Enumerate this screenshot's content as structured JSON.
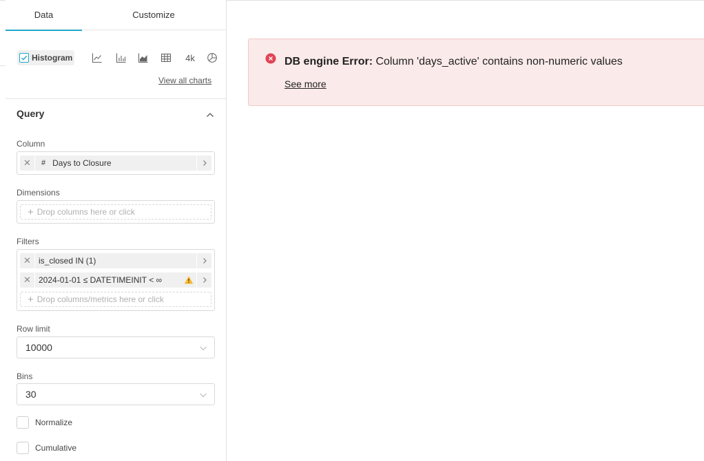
{
  "tabs": {
    "data": "Data",
    "customize": "Customize"
  },
  "viz": {
    "selected_label": "Histogram",
    "icons": [
      "line-chart-icon",
      "bar-chart-icon",
      "area-chart-icon",
      "table-icon",
      "big-number-icon",
      "pie-chart-icon"
    ],
    "big_number_label": "4k",
    "view_all_label": "View all charts"
  },
  "query": {
    "title": "Query",
    "column": {
      "label": "Column",
      "chip_type": "#",
      "chip_label": "Days to Closure"
    },
    "dimensions": {
      "label": "Dimensions",
      "placeholder": "Drop columns here or click"
    },
    "filters": {
      "label": "Filters",
      "items": [
        {
          "label": "is_closed IN (1)"
        },
        {
          "label": "2024-01-01 ≤ DATETIMEINIT < ∞",
          "warning": true
        }
      ],
      "placeholder": "Drop columns/metrics here or click"
    },
    "row_limit": {
      "label": "Row limit",
      "value": "10000"
    },
    "bins": {
      "label": "Bins",
      "value": "30"
    },
    "normalize_label": "Normalize",
    "cumulative_label": "Cumulative"
  },
  "alert": {
    "title": "DB engine Error",
    "message": " Column 'days_active' contains non-numeric values",
    "see_more": "See more",
    "colors": {
      "background": "#fbeaea",
      "icon": "#e04355"
    }
  },
  "accent": "#20a7c9"
}
